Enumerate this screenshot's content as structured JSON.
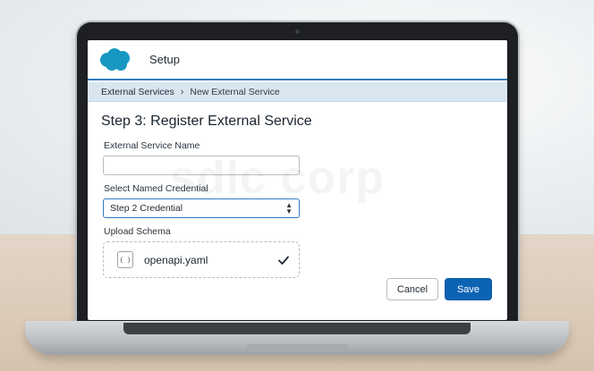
{
  "header": {
    "app_logo": "cloud-logo",
    "title": "Setup"
  },
  "breadcrumb": {
    "parent": "External Services",
    "separator": "›",
    "current": "New External Service"
  },
  "form": {
    "step_title": "Step 3: Register External Service",
    "name_label": "External Service Name",
    "name_value": "",
    "credential_label": "Select Named Credential",
    "credential_value": "Step 2 Credential",
    "schema_label": "Upload Schema",
    "schema_file": "openapi.yaml",
    "file_icon_glyph": "{ }"
  },
  "actions": {
    "cancel_label": "Cancel",
    "save_label": "Save"
  },
  "watermark": {
    "text": "sdlc corp"
  },
  "colors": {
    "brand_blue": "#0d63b3",
    "logo_blue": "#1798c1",
    "breadcrumb_bg": "#d9e6f0"
  }
}
